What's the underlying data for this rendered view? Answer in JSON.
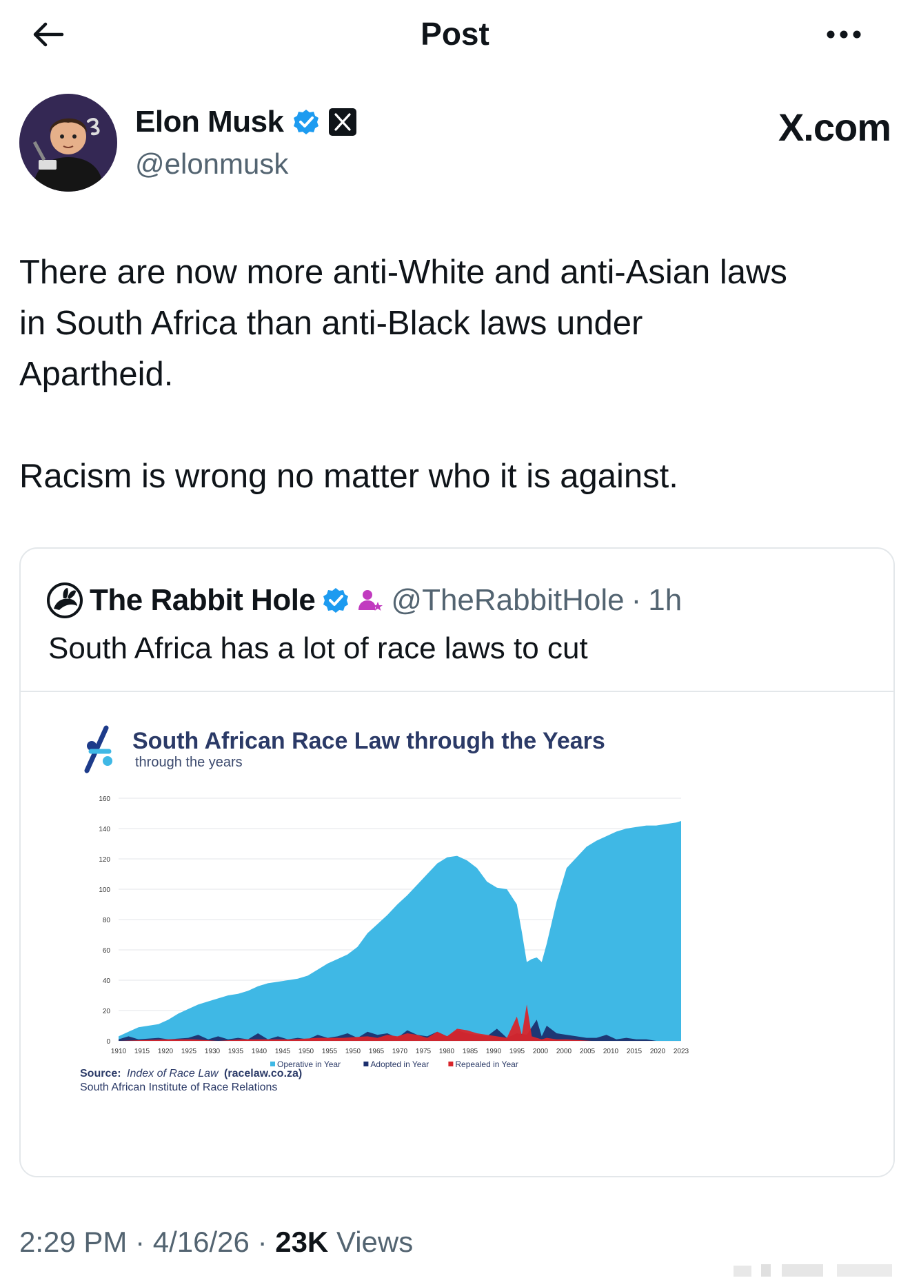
{
  "header": {
    "title": "Post"
  },
  "post": {
    "author_name": "Elon Musk",
    "author_handle": "@elonmusk",
    "site_label": "X.com",
    "text_lines": [
      "There are now more anti-White and anti-Asian laws",
      "in South Africa than anti-Black laws under",
      "Apartheid."
    ],
    "text_second": "Racism is wrong no matter who it is against.",
    "time": "2:29 PM",
    "date": "4/16/26",
    "views_count": "23K",
    "views_label": "Views"
  },
  "quote": {
    "author_name": "The Rabbit Hole",
    "author_handle": "@TheRabbitHole",
    "age": "1h",
    "text": "South Africa has a lot of race laws to cut"
  },
  "colors": {
    "operative": "#3fb8e5",
    "adopted": "#1c2f6e",
    "repealed": "#d8252b",
    "verified": "#1d9bf0",
    "link_gray": "#536471"
  },
  "chart_data": {
    "type": "area",
    "title": "South African Race Law through the Years",
    "subtitle": "through the years",
    "ylim": [
      0,
      160
    ],
    "yticks": [
      0,
      20,
      40,
      60,
      80,
      100,
      120,
      140,
      160
    ],
    "xtick_labels": [
      "1910",
      "1915",
      "1920",
      "1925",
      "1930",
      "1935",
      "1940",
      "1945",
      "1950",
      "1955",
      "1950",
      "1965",
      "1970",
      "1975",
      "1980",
      "1985",
      "1990",
      "1995",
      "2000",
      "2000",
      "2005",
      "2010",
      "2015",
      "2020",
      "2023"
    ],
    "x_range": [
      1910,
      2023
    ],
    "series": [
      {
        "name": "Operative in Year",
        "x": [
          1910,
          1912,
          1914,
          1916,
          1918,
          1920,
          1922,
          1924,
          1926,
          1928,
          1930,
          1932,
          1934,
          1936,
          1938,
          1940,
          1942,
          1944,
          1946,
          1948,
          1950,
          1952,
          1954,
          1956,
          1958,
          1960,
          1962,
          1964,
          1966,
          1968,
          1970,
          1972,
          1974,
          1976,
          1978,
          1980,
          1982,
          1984,
          1986,
          1988,
          1990,
          1991,
          1992,
          1993,
          1994,
          1995,
          1996,
          1998,
          2000,
          2002,
          2004,
          2006,
          2008,
          2010,
          2012,
          2014,
          2016,
          2018,
          2020,
          2022,
          2023
        ],
        "values": [
          3,
          6,
          9,
          10,
          11,
          14,
          18,
          21,
          24,
          26,
          28,
          30,
          31,
          33,
          36,
          38,
          39,
          40,
          41,
          43,
          47,
          51,
          54,
          57,
          62,
          71,
          77,
          83,
          90,
          96,
          103,
          110,
          117,
          121,
          122,
          119,
          114,
          105,
          101,
          100,
          90,
          72,
          52,
          54,
          55,
          52,
          64,
          92,
          114,
          121,
          128,
          132,
          135,
          138,
          140,
          141,
          142,
          142,
          143,
          144,
          145
        ]
      },
      {
        "name": "Adopted in Year",
        "x": [
          1910,
          1912,
          1914,
          1918,
          1920,
          1924,
          1926,
          1928,
          1930,
          1932,
          1934,
          1936,
          1938,
          1940,
          1942,
          1944,
          1946,
          1948,
          1950,
          1952,
          1954,
          1956,
          1958,
          1960,
          1962,
          1964,
          1966,
          1968,
          1970,
          1972,
          1974,
          1976,
          1978,
          1980,
          1982,
          1984,
          1986,
          1988,
          1990,
          1992,
          1994,
          1995,
          1996,
          1998,
          2000,
          2002,
          2004,
          2006,
          2008,
          2010,
          2012,
          2014,
          2016,
          2018,
          2020,
          2023
        ],
        "values": [
          1,
          3,
          1,
          2,
          1,
          2,
          4,
          1,
          3,
          1,
          2,
          1,
          5,
          1,
          3,
          1,
          2,
          1,
          4,
          2,
          3,
          5,
          2,
          6,
          4,
          5,
          2,
          7,
          4,
          3,
          6,
          3,
          7,
          5,
          4,
          3,
          8,
          2,
          5,
          4,
          14,
          3,
          10,
          5,
          4,
          3,
          2,
          2,
          4,
          1,
          2,
          1,
          1,
          0,
          0,
          0
        ]
      },
      {
        "name": "Repealed in Year",
        "x": [
          1910,
          1920,
          1925,
          1930,
          1935,
          1940,
          1945,
          1950,
          1955,
          1960,
          1962,
          1964,
          1966,
          1968,
          1970,
          1972,
          1974,
          1976,
          1978,
          1980,
          1982,
          1984,
          1986,
          1988,
          1990,
          1991,
          1992,
          1993,
          1994,
          1995,
          1996,
          1998,
          2000,
          2005,
          2010,
          2023
        ],
        "values": [
          0,
          1,
          1,
          0,
          1,
          1,
          1,
          2,
          2,
          3,
          2,
          4,
          3,
          5,
          4,
          2,
          6,
          3,
          8,
          7,
          5,
          4,
          3,
          2,
          16,
          4,
          24,
          3,
          2,
          1,
          2,
          1,
          1,
          0,
          0,
          0
        ]
      }
    ],
    "source_label": "Source:",
    "source_italic": "Index of Race Law",
    "source_link": "(racelaw.co.za)",
    "source_org": "South African Institute of Race Relations"
  }
}
